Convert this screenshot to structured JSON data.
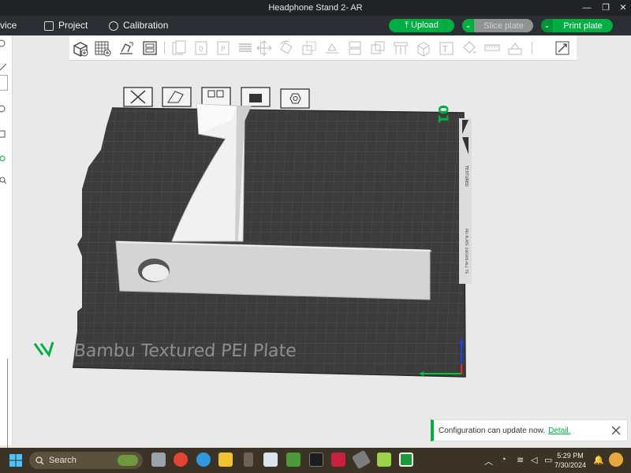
{
  "window": {
    "title": "Headphone Stand 2- AR"
  },
  "menubar": {
    "device_label": "vice",
    "project_label": "Project",
    "calibration_label": "Calibration",
    "upload_label": "Upload",
    "slice_label": "Slice plate",
    "print_label": "Print plate"
  },
  "plate": {
    "name": "Bambu Textured PEI Plate",
    "number": "01",
    "side_labels": [
      "TEXTURED",
      "PEI PLATE 240305-ALL TS"
    ]
  },
  "notification": {
    "message": "Configuration can update now.",
    "link": "Detail."
  },
  "taskbar": {
    "search_placeholder": "Search",
    "time": "5:29 PM",
    "date": "7/30/2024"
  },
  "colors": {
    "accent": "#00ae42",
    "bed": "#3c3c3c",
    "model": "#c9c9c9",
    "menubar": "#2b2f33"
  }
}
